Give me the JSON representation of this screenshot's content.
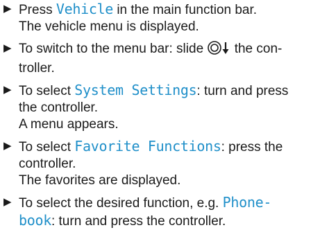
{
  "colors": {
    "ui_term": "#1f8fc9",
    "text": "#1a1a1a"
  },
  "steps": [
    {
      "parts": {
        "a": "Press ",
        "ui": "Vehicle",
        "b": " in the main function bar."
      },
      "result": "The vehicle menu is displayed."
    },
    {
      "parts": {
        "a": "To switch to the menu bar: slide ",
        "icon": "controller-slide-down-icon",
        "b": " the con-",
        "c": "troller."
      }
    },
    {
      "parts": {
        "a": "To select ",
        "ui": "System Settings",
        "b": ": turn and press",
        "c": "the controller."
      },
      "result": "A menu appears."
    },
    {
      "parts": {
        "a": "To select ",
        "ui": "Favorite Functions",
        "b": ": press the",
        "c": "controller."
      },
      "result": "The favorites are displayed."
    },
    {
      "parts": {
        "a": "To select the desired function, e.g. ",
        "ui_1": "Phone-",
        "ui_2": "book",
        "b": ": turn and press the controller."
      }
    }
  ]
}
